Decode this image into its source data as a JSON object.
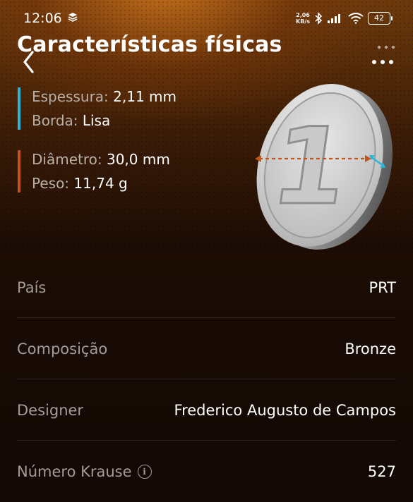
{
  "status_bar": {
    "time": "12:06",
    "net_speed_value": "2,06",
    "net_speed_unit": "KB/s",
    "battery": "42"
  },
  "header": {
    "title": "Características físicas"
  },
  "specs": {
    "group1": {
      "accent": "#2bb5d6",
      "thickness_label": "Espessura:",
      "thickness_value": "2,11 mm",
      "edge_label": "Borda:",
      "edge_value": "Lisa"
    },
    "group2": {
      "accent": "#c2541c",
      "diameter_label": "Diâmetro:",
      "diameter_value": "30,0 mm",
      "weight_label": "Peso:",
      "weight_value": "11,74 g"
    }
  },
  "coin": {
    "numeral": "1"
  },
  "details": [
    {
      "label": "País",
      "value": "PRT",
      "flag": "portugal-flag-icon"
    },
    {
      "label": "Composição",
      "value": "Bronze"
    },
    {
      "label": "Designer",
      "value": "Frederico Augusto de Campos"
    },
    {
      "label": "Número Krause",
      "value": "527",
      "icon": "info-icon"
    }
  ]
}
